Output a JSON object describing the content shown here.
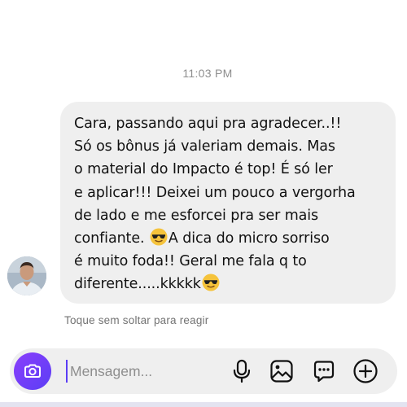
{
  "thread": {
    "timestamp": "11:03 PM"
  },
  "message": {
    "line_1": "Cara, passando aqui pra agradecer..!!",
    "line_2": "Só os bônus já valeriam demais. Mas",
    "line_3": "o material do Impacto é top! É só ler",
    "line_4": "e aplicar!!! Deixei um pouco a vergorha",
    "line_5": "de lado e me esforcei pra ser mais",
    "line_6a": "confiante. ",
    "line_6b": "A dica do micro sorriso",
    "line_7": "é muito foda!! Geral me fala q to",
    "line_8": "diferente.....kkkkk",
    "emoji": "smiling-face-with-sunglasses"
  },
  "hint": {
    "text": "Toque sem soltar para reagir"
  },
  "composer": {
    "placeholder": "Mensagem...",
    "icons": [
      "camera-icon",
      "microphone-icon",
      "image-icon",
      "sticker-icon",
      "plus-icon"
    ]
  },
  "colors": {
    "accent": "#5b3df5",
    "bubble": "#efefef",
    "muted_text": "#8e8e8e"
  }
}
